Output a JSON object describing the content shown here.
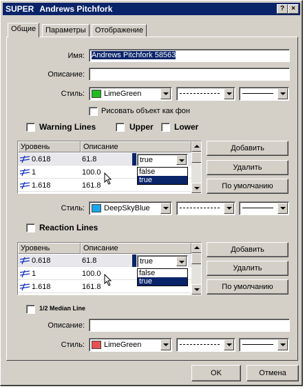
{
  "window": {
    "title_app": "SUPER",
    "title_object": "Andrews Pitchfork",
    "help_btn": "?",
    "close_btn": "×"
  },
  "tabs": [
    {
      "label": "Общие",
      "active": true
    },
    {
      "label": "Параметры",
      "active": false
    },
    {
      "label": "Отображение",
      "active": false
    }
  ],
  "general": {
    "name_label": "Имя:",
    "name_value": "Andrews Pitchfork 58563",
    "desc_label": "Описание:",
    "desc_value": "",
    "style_label": "Стиль:",
    "color_name": "LimeGreen",
    "color_hex": "#22bb22",
    "background_label": "Рисовать объект как фон"
  },
  "warning": {
    "warning_label": "Warning Lines",
    "upper_label": "Upper",
    "lower_label": "Lower",
    "col_level": "Уровень",
    "col_desc": "Описание",
    "rows": [
      {
        "level": "0.618",
        "desc": "61.8",
        "value": "true"
      },
      {
        "level": "1",
        "desc": "100.0"
      },
      {
        "level": "1.618",
        "desc": "161.8"
      }
    ],
    "options": [
      "false",
      "true"
    ],
    "add_btn": "Добавить",
    "delete_btn": "Удалить",
    "default_btn": "По умолчанию",
    "style_label": "Стиль:",
    "color_name": "DeepSkyBlue",
    "color_hex": "#1aa6ea"
  },
  "reaction": {
    "label": "Reaction Lines",
    "col_level": "Уровень",
    "col_desc": "Описание",
    "rows": [
      {
        "level": "0.618",
        "desc": "61.8",
        "value": "true"
      },
      {
        "level": "1",
        "desc": "100.0"
      },
      {
        "level": "1.618",
        "desc": "161.8"
      }
    ],
    "options": [
      "false",
      "true"
    ],
    "add_btn": "Добавить",
    "delete_btn": "Удалить",
    "default_btn": "По умолчанию"
  },
  "median": {
    "label": "1/2 Median Line",
    "desc_label": "Описание:",
    "desc_value": "",
    "style_label": "Стиль:",
    "color_name": "LimeGreen",
    "color_hex": "#e85050"
  },
  "footer": {
    "ok": "OK",
    "cancel": "Отмена"
  }
}
